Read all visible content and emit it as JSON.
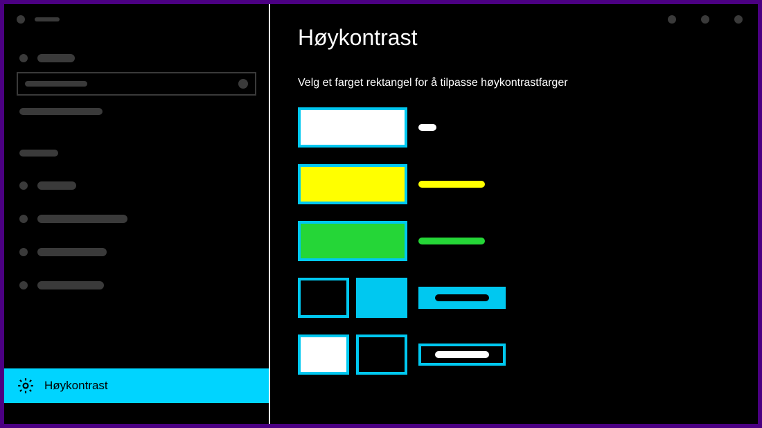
{
  "window": {
    "title_dots": 3
  },
  "sidebar": {
    "active_label": "Høykontrast"
  },
  "content": {
    "title": "Høykontrast",
    "subtitle": "Velg et farget rektangel for å tilpasse høykontrastfarger",
    "swatches": [
      {
        "kind": "single",
        "fill": "#ffffff",
        "label_color": "#ffffff",
        "label_w": 26
      },
      {
        "kind": "single",
        "fill": "#ffff00",
        "label_color": "#ffff00",
        "label_w": 96
      },
      {
        "kind": "single",
        "fill": "#25d637",
        "label_color": "#25d637",
        "label_w": 96
      },
      {
        "kind": "pair",
        "left": "#000000",
        "right": "#00c8f0",
        "button": "fill",
        "button_bg": "#00c8f0",
        "pill_color": "#000000",
        "pill_w": 78
      },
      {
        "kind": "pair",
        "left": "#ffffff",
        "right": "#000000",
        "button": "outline",
        "button_bg": "#000000",
        "pill_color": "#ffffff",
        "pill_w": 78
      }
    ]
  },
  "colors": {
    "accent": "#00c8f0",
    "purple_frame": "#4b0082"
  }
}
